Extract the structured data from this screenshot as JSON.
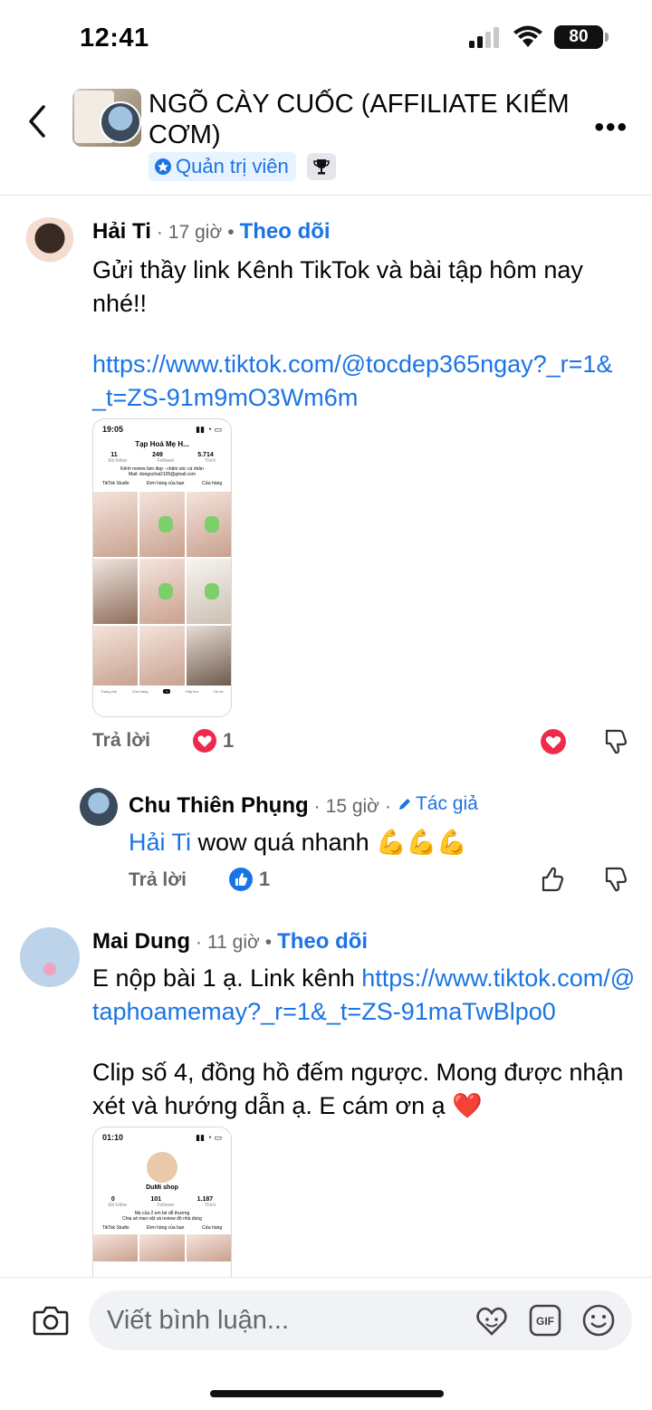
{
  "status_bar": {
    "time": "12:41",
    "battery": "80"
  },
  "header": {
    "group_title": "NGÕ CÀY CUỐC (AFFILIATE KIẾM CƠM)",
    "role": "Quản trị viên"
  },
  "comments": [
    {
      "author": "Hải Ti",
      "time": "17 giờ",
      "follow": "Theo dõi",
      "text": "Gửi thầy link Kênh TikTok và bài tập hôm nay nhé!!",
      "link": "https://www.tiktok.com/@tocdep365ngay?_r=1&_t=ZS-91m9mO3Wm6m",
      "reply_label": "Trả lời",
      "reaction_count": "1",
      "screenshot": {
        "time": "19:05",
        "profile": "Tạp Hoá Mẹ H...",
        "stats": [
          "11",
          "249",
          "5.714"
        ],
        "stat_labels": [
          "Đã follow",
          "Follower",
          "Thích"
        ],
        "bio": "Kênh review làm đẹp - chăm sóc cá nhân",
        "mail": "Mail: dongochai2105@gmail.com",
        "buttons": [
          "TikTok Studio",
          "Đơn hàng của bạn",
          "Cửa hàng"
        ],
        "nav": [
          "Trang chủ",
          "Cửa hàng",
          "Hộp thư",
          "Hồ sơ"
        ]
      }
    },
    {
      "author": "Chu Thiên Phụng",
      "time": "15 giờ",
      "badge": "Tác giả",
      "mention": "Hải Ti",
      "text": "wow quá nhanh 💪💪💪",
      "reply_label": "Trả lời",
      "reaction_count": "1"
    },
    {
      "author": "Mai Dung",
      "time": "11 giờ",
      "follow": "Theo dõi",
      "text_before": "E nộp bài 1 ạ. Link kênh ",
      "link": "https://www.tiktok.com/@taphoamemay?_r=1&_t=ZS-91maTwBlpo0",
      "text_after": "Clip số 4, đồng hồ đếm ngược. Mong được nhận xét và hướng dẫn ạ. E cám ơn ạ ❤️",
      "screenshot": {
        "time": "01:10",
        "profile": "DuMi shop",
        "stats": [
          "0",
          "101",
          "1.187"
        ],
        "stat_labels": [
          "Đã follow",
          "Follower",
          "Thích"
        ],
        "bio": "Mẹ của 2 em bé dễ thương",
        "bio2": "Chia sẻ mẹo vặt và review đồ nhà dùng",
        "buttons": [
          "TikTok Studio",
          "Đơn hàng của bạn",
          "Cửa hàng"
        ]
      }
    }
  ],
  "composer": {
    "placeholder": "Viết bình luận..."
  },
  "colors": {
    "accent": "#1b74e4",
    "love": "#f02849",
    "text": "#050505",
    "muted": "#65676b"
  }
}
